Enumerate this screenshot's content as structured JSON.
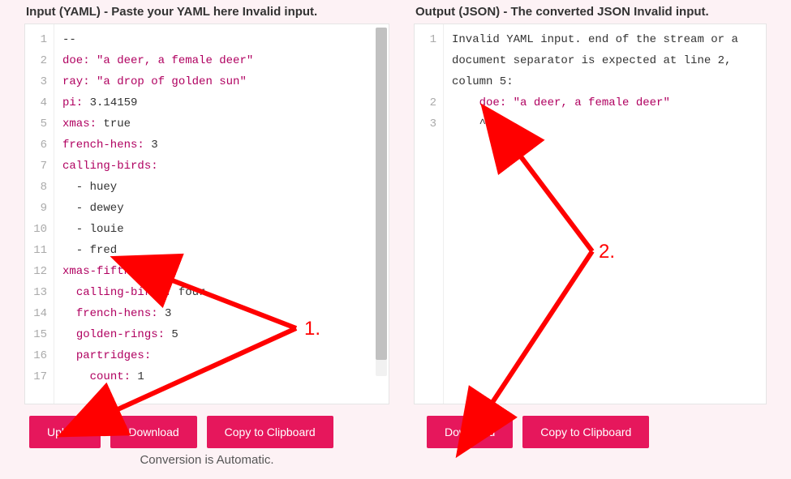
{
  "input": {
    "header": "Input (YAML) - Paste your YAML here Invalid input.",
    "gutter": [
      "1",
      "2",
      "3",
      "4",
      "5",
      "6",
      "7",
      "8",
      "9",
      "10",
      "11",
      "12",
      "13",
      "14",
      "15",
      "16",
      "17"
    ],
    "lines": [
      [
        {
          "t": "--",
          "c": "plain"
        }
      ],
      [
        {
          "t": "doe:",
          "c": "key"
        },
        {
          "t": " ",
          "c": "plain"
        },
        {
          "t": "\"a deer, a female deer\"",
          "c": "str"
        }
      ],
      [
        {
          "t": "ray:",
          "c": "key"
        },
        {
          "t": " ",
          "c": "plain"
        },
        {
          "t": "\"a drop of golden sun\"",
          "c": "str"
        }
      ],
      [
        {
          "t": "pi:",
          "c": "key"
        },
        {
          "t": " 3.14159",
          "c": "plain"
        }
      ],
      [
        {
          "t": "xmas:",
          "c": "key"
        },
        {
          "t": " true",
          "c": "plain"
        }
      ],
      [
        {
          "t": "french-hens:",
          "c": "key"
        },
        {
          "t": " 3",
          "c": "plain"
        }
      ],
      [
        {
          "t": "calling-birds:",
          "c": "key"
        }
      ],
      [
        {
          "t": "  - huey",
          "c": "plain"
        }
      ],
      [
        {
          "t": "  - dewey",
          "c": "plain"
        }
      ],
      [
        {
          "t": "  - louie",
          "c": "plain"
        }
      ],
      [
        {
          "t": "  - fred",
          "c": "plain"
        }
      ],
      [
        {
          "t": "xmas-fifth-day:",
          "c": "key"
        }
      ],
      [
        {
          "t": "  ",
          "c": "plain"
        },
        {
          "t": "calling-birds:",
          "c": "key"
        },
        {
          "t": " four",
          "c": "plain"
        }
      ],
      [
        {
          "t": "  ",
          "c": "plain"
        },
        {
          "t": "french-hens:",
          "c": "key"
        },
        {
          "t": " 3",
          "c": "plain"
        }
      ],
      [
        {
          "t": "  ",
          "c": "plain"
        },
        {
          "t": "golden-rings:",
          "c": "key"
        },
        {
          "t": " 5",
          "c": "plain"
        }
      ],
      [
        {
          "t": "  ",
          "c": "plain"
        },
        {
          "t": "partridges:",
          "c": "key"
        }
      ],
      [
        {
          "t": "    ",
          "c": "plain"
        },
        {
          "t": "count:",
          "c": "key"
        },
        {
          "t": " 1",
          "c": "plain"
        }
      ]
    ],
    "buttons": {
      "upload": "Upload",
      "download": "Download",
      "copy": "Copy to Clipboard"
    },
    "footer": "Conversion is Automatic."
  },
  "output": {
    "header": "Output (JSON) - The converted JSON Invalid input.",
    "gutter": [
      "1",
      "",
      "",
      "2",
      "3"
    ],
    "lines": [
      [
        {
          "t": "Invalid YAML input. end of the stream or a",
          "c": "plain"
        }
      ],
      [
        {
          "t": "document separator is expected at line 2,",
          "c": "plain"
        }
      ],
      [
        {
          "t": "column 5:",
          "c": "plain"
        }
      ],
      [
        {
          "t": "    ",
          "c": "plain"
        },
        {
          "t": "doe:",
          "c": "key"
        },
        {
          "t": " ",
          "c": "plain"
        },
        {
          "t": "\"a deer, a female deer\"",
          "c": "str"
        }
      ],
      [
        {
          "t": "    ^",
          "c": "plain"
        }
      ]
    ],
    "buttons": {
      "download": "Download",
      "copy": "Copy to Clipboard"
    }
  },
  "annotations": {
    "a1": "1.",
    "a2": "2."
  }
}
